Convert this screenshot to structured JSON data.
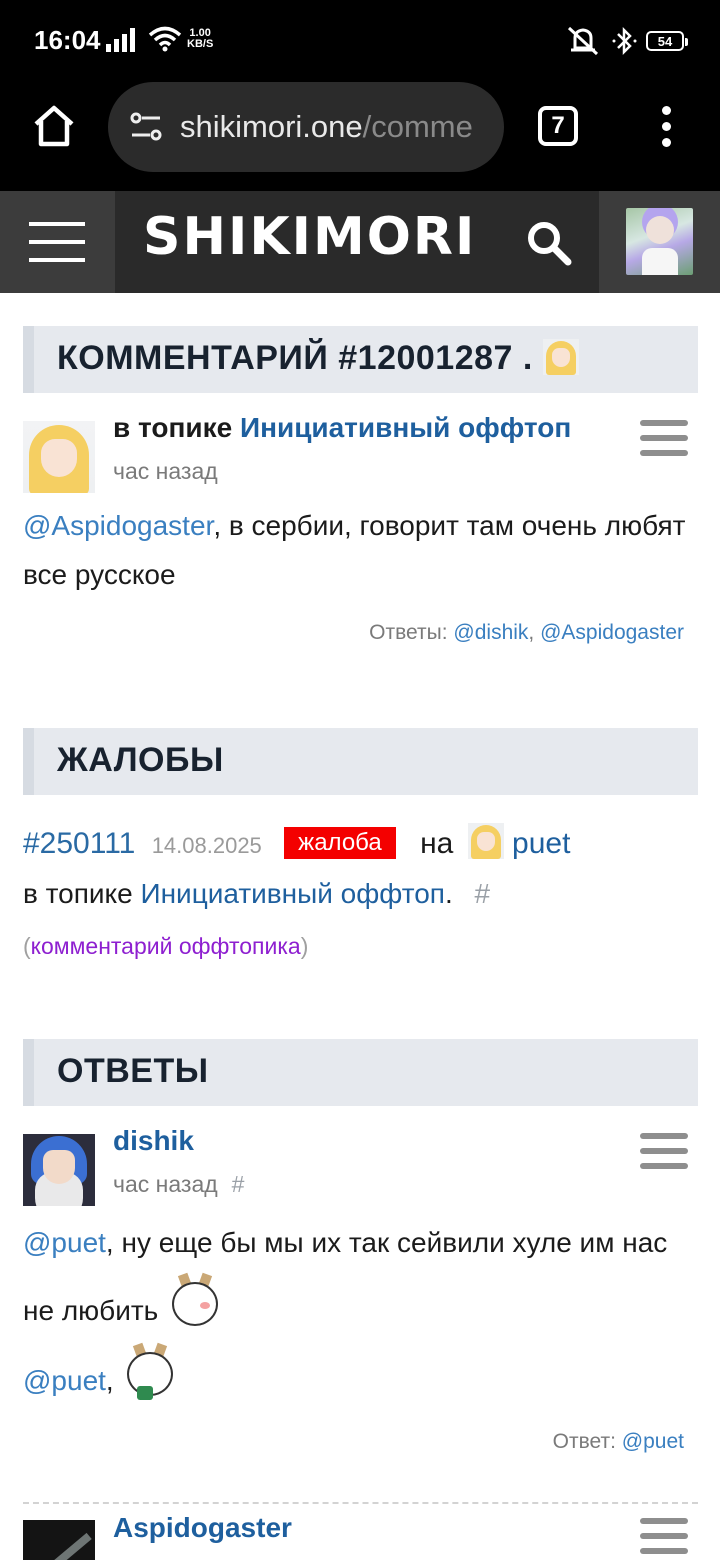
{
  "status_bar": {
    "time": "16:04",
    "net_speed_value": "1.00",
    "net_speed_unit": "KB/S",
    "battery": "54"
  },
  "browser": {
    "url_host": "shikimori.one",
    "url_path": "/comme",
    "tab_count": "7"
  },
  "site": {
    "logo": "SHIKIMORI"
  },
  "comment": {
    "section_title": "КОММЕНТАРИЙ #12001287 .",
    "topic_prefix": "в топике",
    "topic_name": "Инициативный оффтоп",
    "time": "час назад",
    "mention": "@Aspidogaster",
    "text_rest": ", в сербии, говорит там очень любят все русское",
    "replies_label": "Ответы:",
    "replies": [
      "@dishik",
      "@Aspidogaster"
    ]
  },
  "complaints": {
    "section_title": "ЖАЛОБЫ",
    "id": "#250111",
    "date": "14.08.2025",
    "tag": "жалоба",
    "on_word": "на",
    "user": "puet",
    "topic_prefix": "в топике",
    "topic_name": "Инициативный оффтоп",
    "topic_suffix": ".",
    "hash": "#",
    "paren_open": "(",
    "label": "комментарий оффтопика",
    "paren_close": ")"
  },
  "answers": {
    "section_title": "ОТВЕТЫ",
    "items": [
      {
        "author": "dishik",
        "time": "час назад",
        "hash": "#",
        "mention1": "@puet",
        "text1": ", ну еще бы мы их так сейвили хуле им нас не любить",
        "mention2": "@puet",
        "text2": ",",
        "reply_label": "Ответ:",
        "reply_user": "@puet"
      },
      {
        "author": "Aspidogaster"
      }
    ]
  },
  "colors": {
    "link": "#1e5f9e",
    "section_bg": "#e6e9ee",
    "complaint_tag": "#f40000",
    "purple_label": "#8e1fd0"
  }
}
